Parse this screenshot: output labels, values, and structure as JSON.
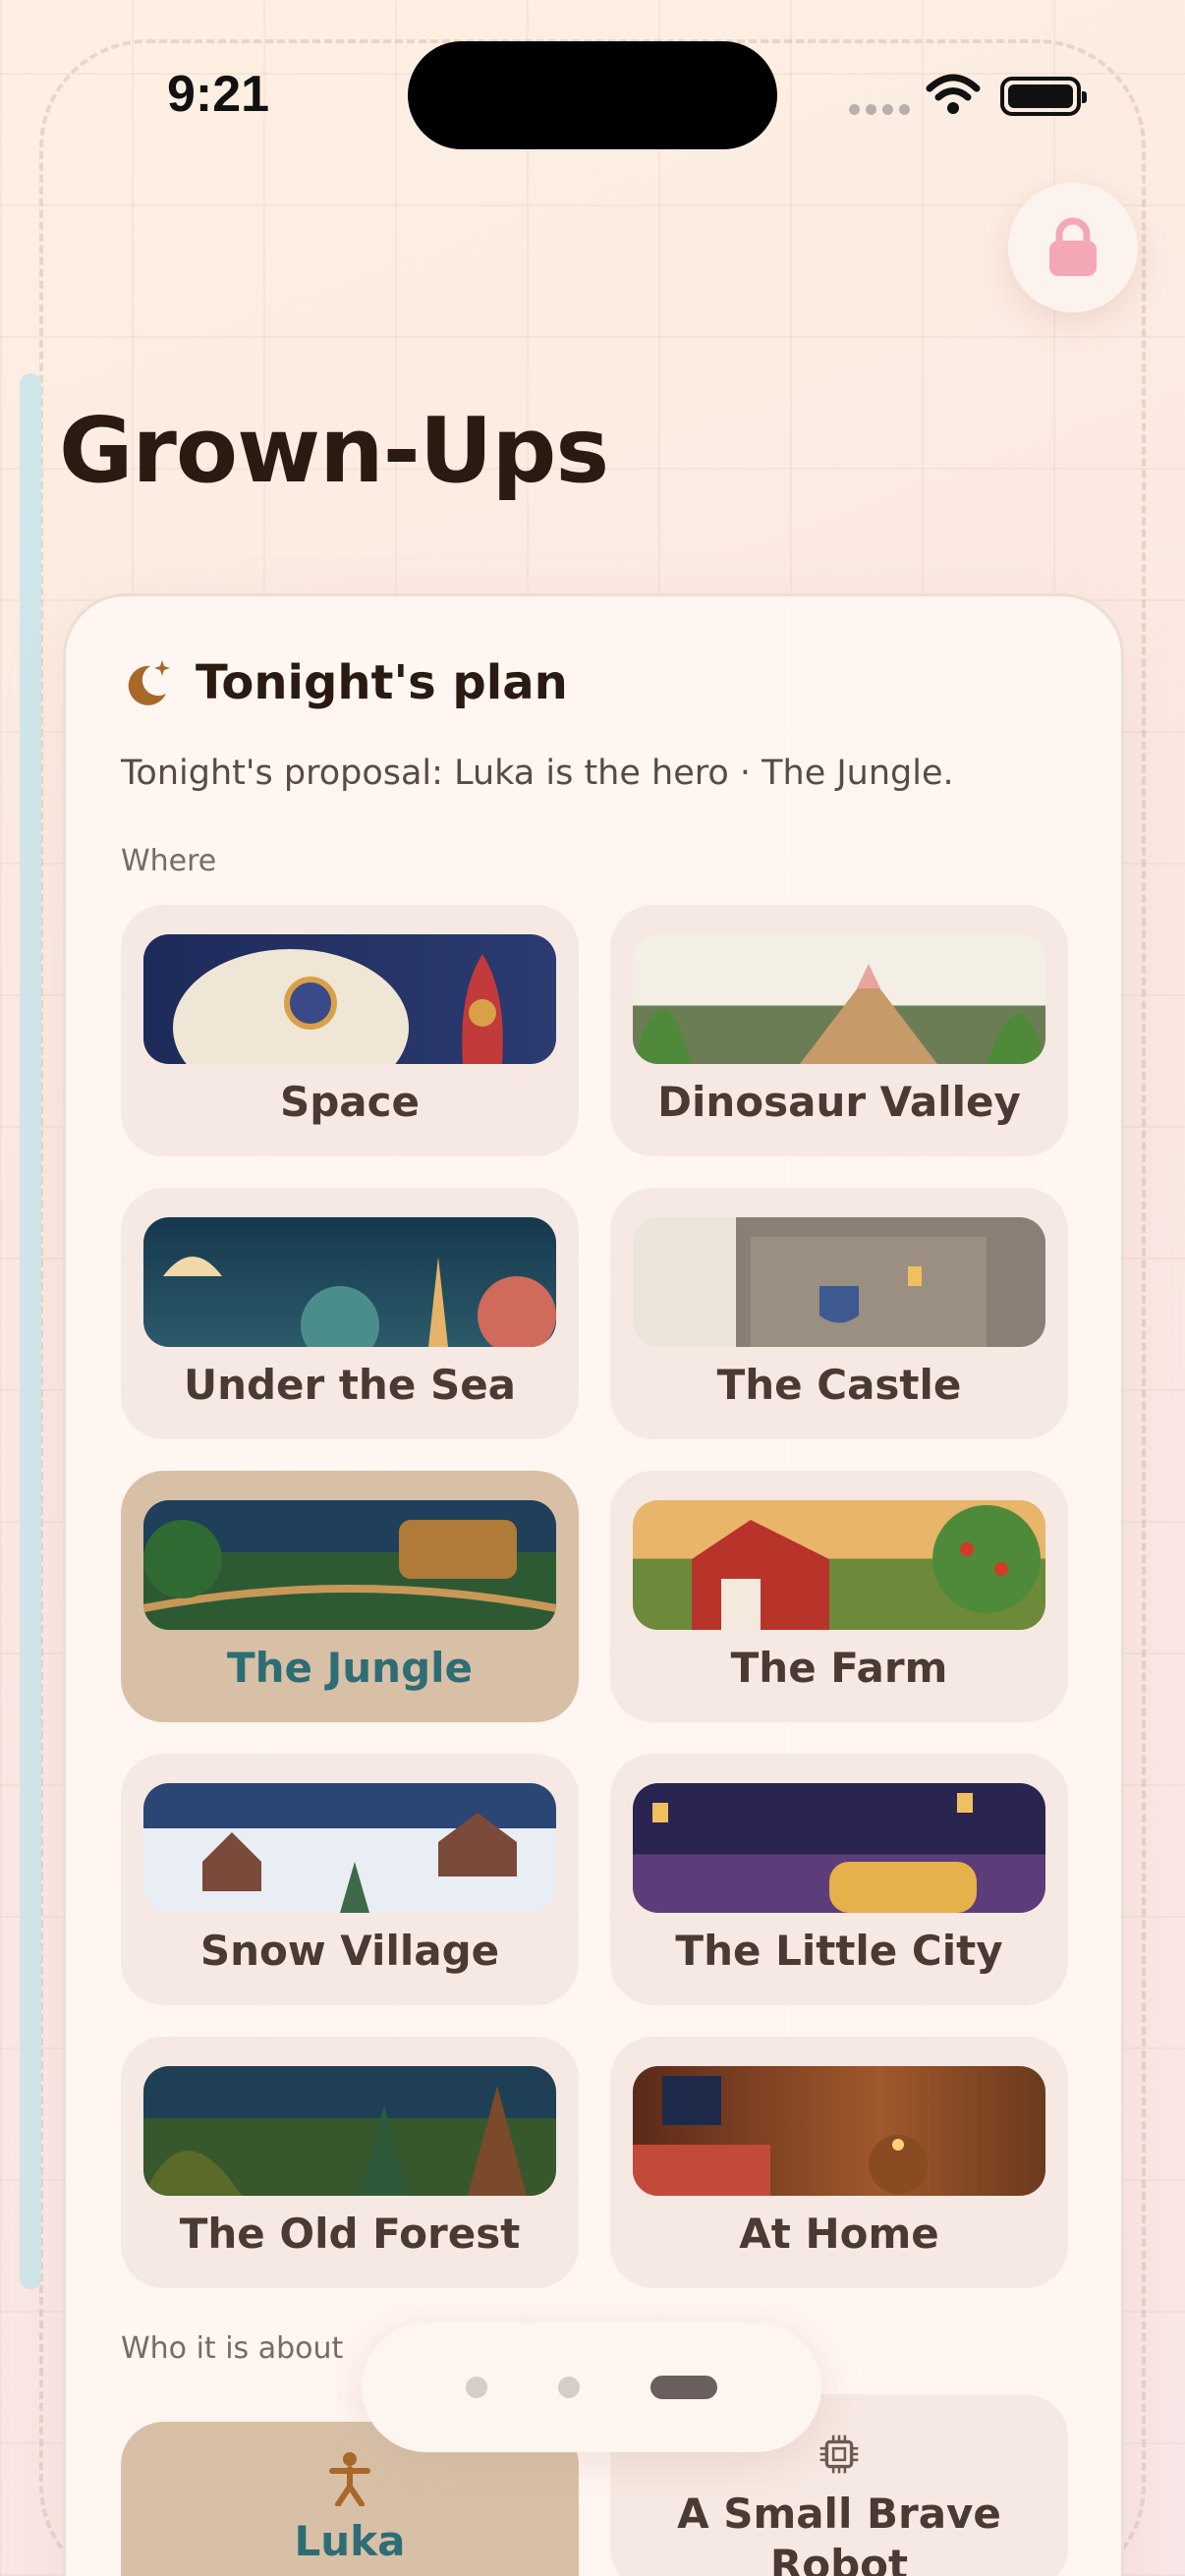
{
  "status_bar": {
    "time": "9:21"
  },
  "colors": {
    "accent_teal": "#2e6d75",
    "selected_tile": "#d7c0a6",
    "lock_pink": "#f4a7b4"
  },
  "header": {
    "title": "Grown-Ups",
    "lock_icon": "lock-icon"
  },
  "plan": {
    "title": "Tonight's plan",
    "icon": "moon-sparkle-icon",
    "proposal": "Tonight's proposal: Luka is the hero · The Jungle.",
    "where_label": "Where",
    "places": [
      {
        "label": "Space",
        "selected": false
      },
      {
        "label": "Dinosaur Valley",
        "selected": false
      },
      {
        "label": "Under the Sea",
        "selected": false
      },
      {
        "label": "The Castle",
        "selected": false
      },
      {
        "label": "The Jungle",
        "selected": true
      },
      {
        "label": "The Farm",
        "selected": false
      },
      {
        "label": "Snow Village",
        "selected": false
      },
      {
        "label": "The Little City",
        "selected": false
      },
      {
        "label": "The Old Forest",
        "selected": false
      },
      {
        "label": "At Home",
        "selected": false
      }
    ],
    "who_label": "Who it is about",
    "heroes": [
      {
        "label": "Luka",
        "icon": "child-figure-icon",
        "selected": true
      },
      {
        "label": "A Small Brave Robot",
        "icon": "chip-icon",
        "selected": false
      }
    ]
  },
  "pager": {
    "pages": 3,
    "active_page": 3
  }
}
